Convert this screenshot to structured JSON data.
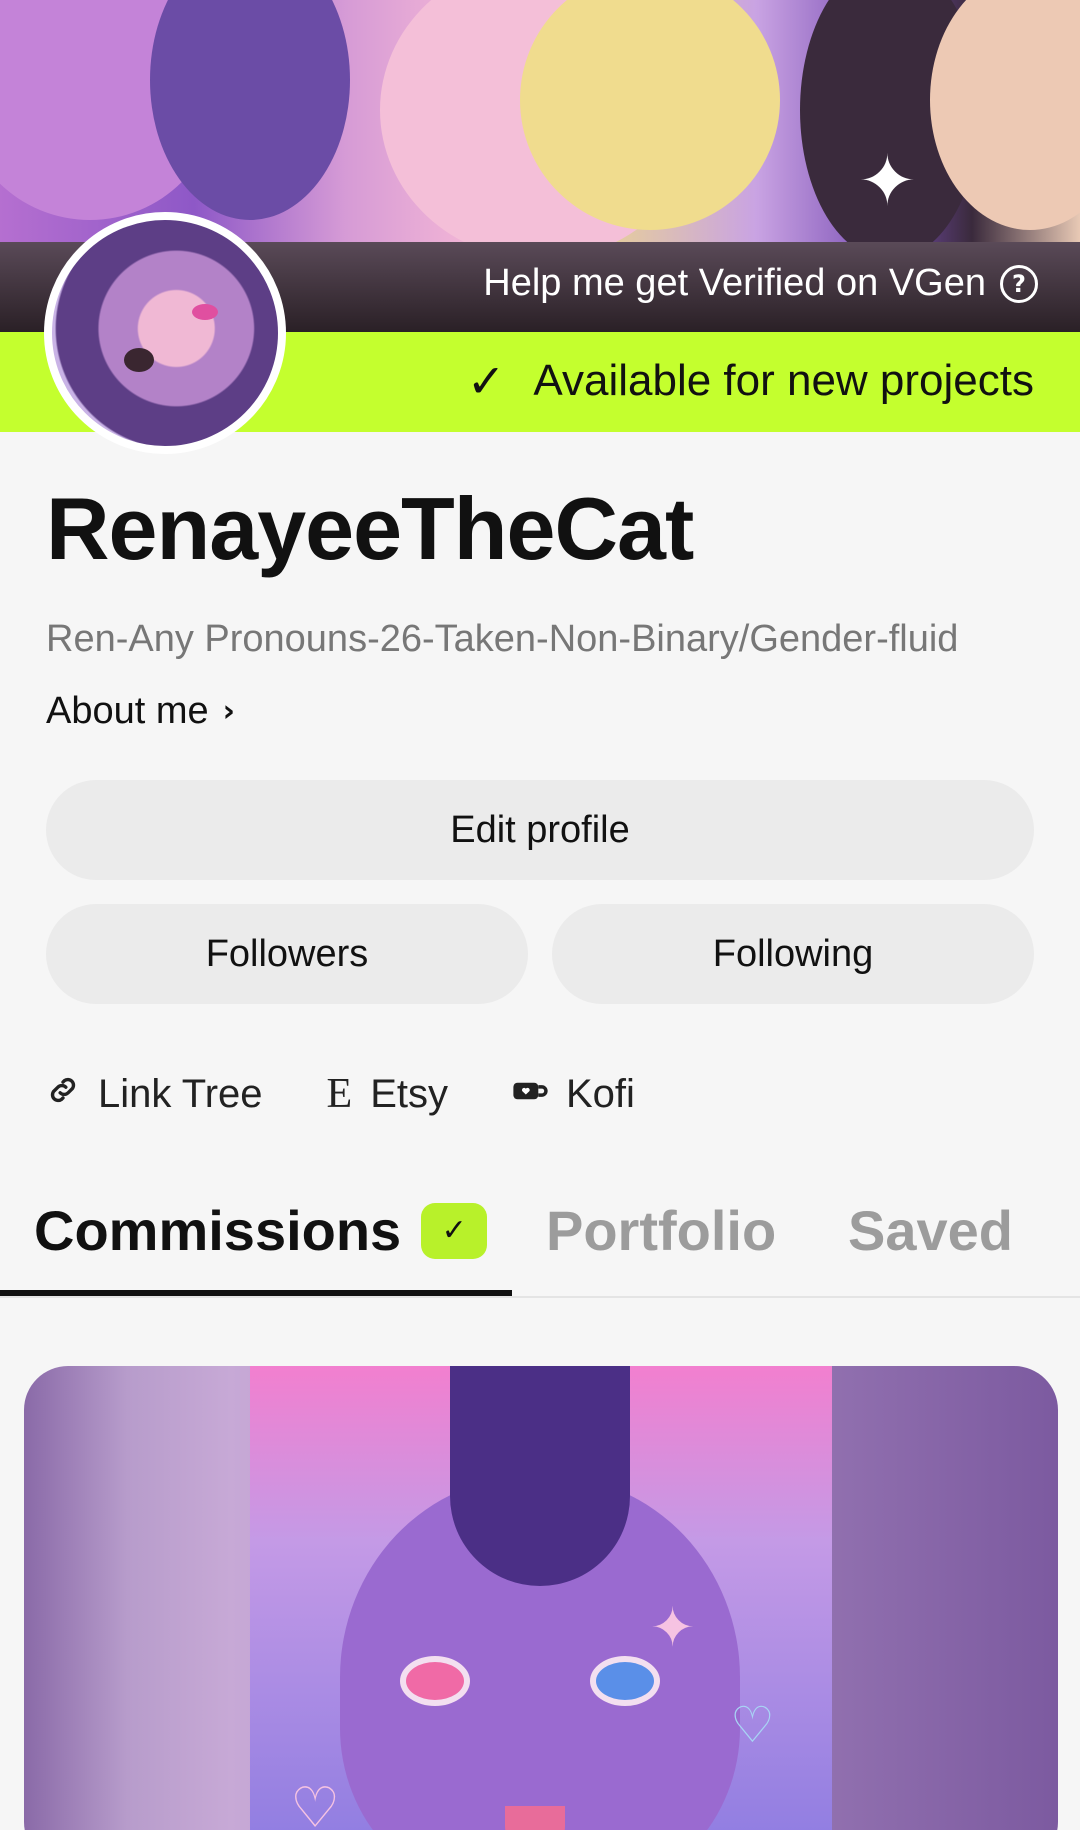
{
  "banner": {
    "verified_text": "Help me get Verified on VGen",
    "available_text": "Available for new projects",
    "colors": {
      "available_bg": "#c4ff2e",
      "verified_bg": "#2a2026"
    }
  },
  "profile": {
    "username": "RenayeeTheCat",
    "bio": "Ren-Any Pronouns-26-Taken-Non-Binary/Gender-fluid",
    "about_label": "About me"
  },
  "buttons": {
    "edit_profile": "Edit profile",
    "followers": "Followers",
    "following": "Following"
  },
  "links": [
    {
      "label": "Link Tree",
      "icon": "link-icon"
    },
    {
      "label": "Etsy",
      "icon": "etsy-icon"
    },
    {
      "label": "Kofi",
      "icon": "kofi-cup-icon"
    }
  ],
  "tabs": [
    {
      "label": "Commissions",
      "active": true
    },
    {
      "label": "Portfolio",
      "active": false
    },
    {
      "label": "Saved",
      "active": false
    }
  ],
  "icons": {
    "check": "✓",
    "help": "?",
    "chevron": "›",
    "link": "🔗",
    "etsy": "E",
    "kofi": "☕"
  }
}
